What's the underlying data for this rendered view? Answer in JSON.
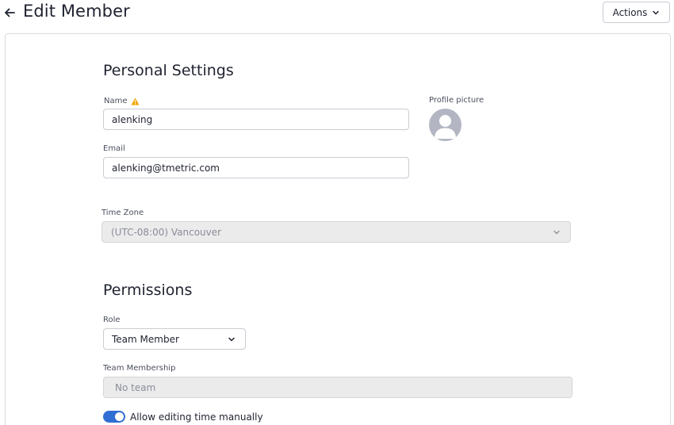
{
  "header": {
    "title": "Edit Member",
    "actions_label": "Actions"
  },
  "personal": {
    "section_title": "Personal Settings",
    "name_label": "Name",
    "name_value": "alenking",
    "email_label": "Email",
    "email_value": "alenking@tmetric.com",
    "profile_picture_label": "Profile picture",
    "timezone_label": "Time Zone",
    "timezone_value": "(UTC-08:00) Vancouver"
  },
  "permissions": {
    "section_title": "Permissions",
    "role_label": "Role",
    "role_value": "Team Member",
    "team_membership_label": "Team Membership",
    "team_membership_value": "No team",
    "allow_editing_label": "Allow editing time manually",
    "allow_editing_enabled": true
  },
  "icons": {
    "back": "arrow-left-icon",
    "warning": "warning-icon",
    "chevron": "chevron-down-icon",
    "avatar": "user-avatar-icon"
  },
  "colors": {
    "accent": "#2f6ed3",
    "warning": "#f0a500",
    "disabled_bg": "#ebebec"
  }
}
